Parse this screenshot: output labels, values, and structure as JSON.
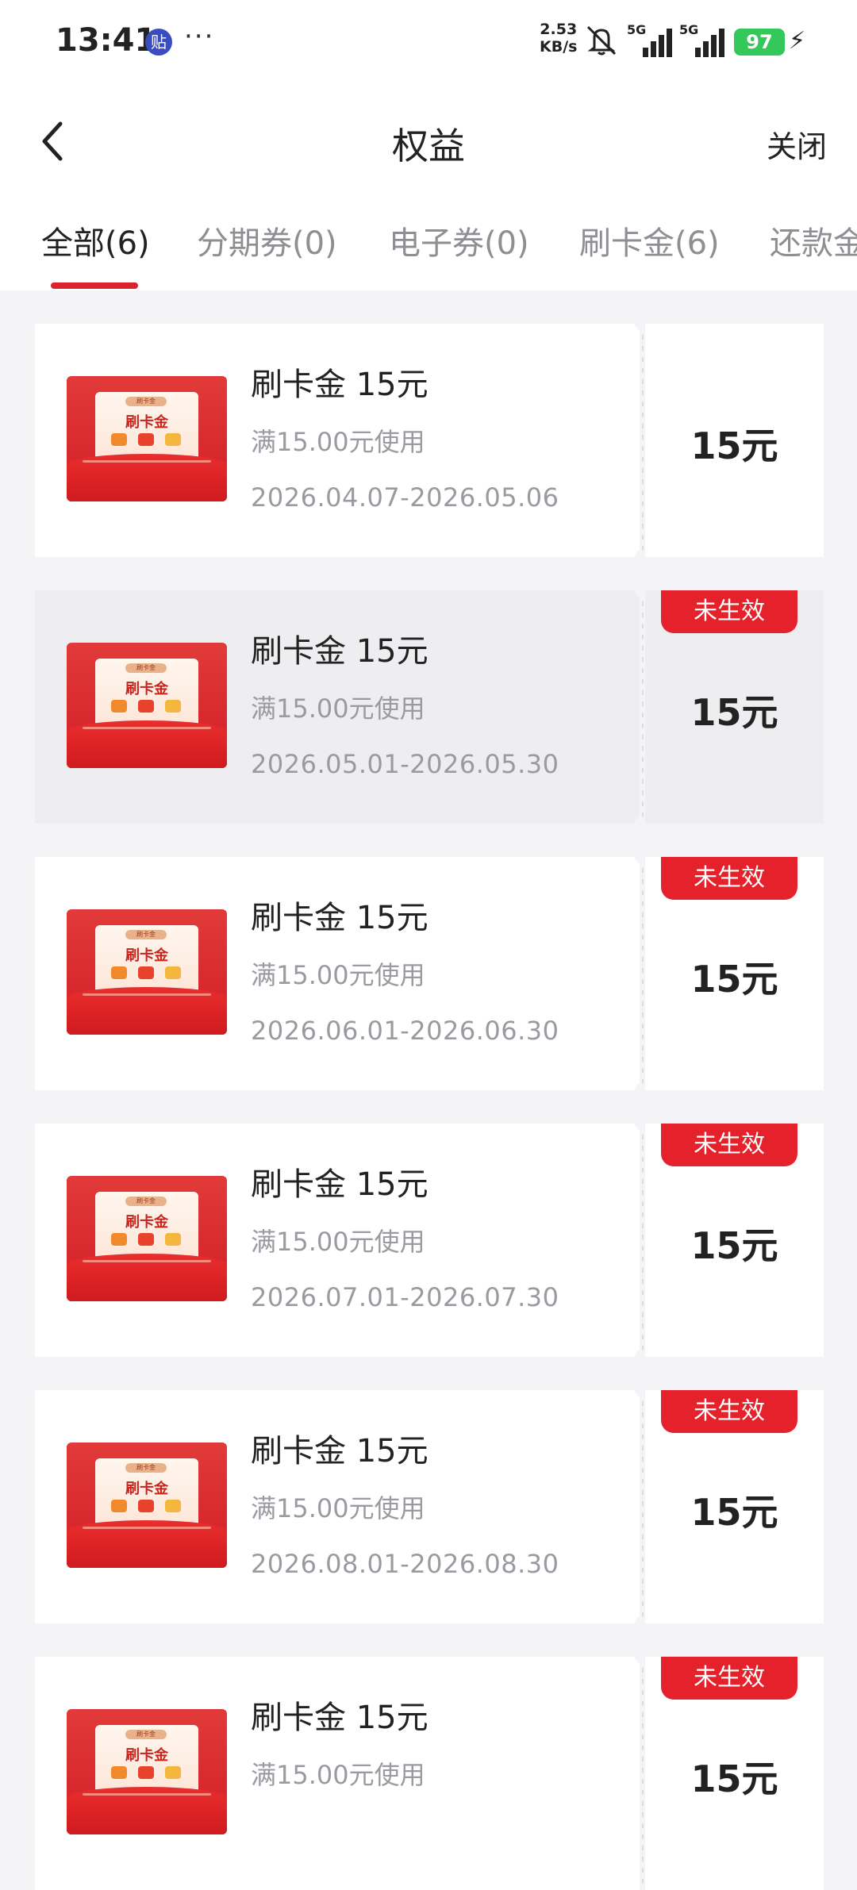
{
  "status_bar": {
    "time": "13:41",
    "app_badge": "贴",
    "more": "···",
    "net_speed_value": "2.53",
    "net_speed_unit": "KB/s",
    "signal1_label": "5G",
    "signal2_label": "5G",
    "battery": "97",
    "icons": [
      "mute-icon",
      "signal-icon",
      "battery-icon",
      "charging-icon"
    ]
  },
  "header": {
    "title": "权益",
    "close_label": "关闭",
    "back_icon": "chevron-left-icon"
  },
  "tabs": [
    {
      "label": "全部(6)",
      "active": true
    },
    {
      "label": "分期券(0)",
      "active": false
    },
    {
      "label": "电子券(0)",
      "active": false
    },
    {
      "label": "刷卡金(6)",
      "active": false
    },
    {
      "label": "还款金",
      "active": false
    }
  ],
  "thumb_text": {
    "tag": "刷卡金",
    "label": "刷卡金"
  },
  "cards": [
    {
      "title": "刷卡金 15元",
      "condition": "满15.00元使用",
      "date_range": "2026.04.07-2026.05.06",
      "amount": "15元",
      "badge": ""
    },
    {
      "title": "刷卡金 15元",
      "condition": "满15.00元使用",
      "date_range": "2026.05.01-2026.05.30",
      "amount": "15元",
      "badge": "未生效"
    },
    {
      "title": "刷卡金 15元",
      "condition": "满15.00元使用",
      "date_range": "2026.06.01-2026.06.30",
      "amount": "15元",
      "badge": "未生效"
    },
    {
      "title": "刷卡金 15元",
      "condition": "满15.00元使用",
      "date_range": "2026.07.01-2026.07.30",
      "amount": "15元",
      "badge": "未生效"
    },
    {
      "title": "刷卡金 15元",
      "condition": "满15.00元使用",
      "date_range": "2026.08.01-2026.08.30",
      "amount": "15元",
      "badge": "未生效"
    },
    {
      "title": "刷卡金 15元",
      "condition": "满15.00元使用",
      "date_range": "",
      "amount": "15元",
      "badge": "未生效"
    }
  ],
  "colors": {
    "accent": "#d9222c",
    "badge": "#e5222b",
    "page_bg": "#f4f4f6",
    "battery": "#34c759"
  }
}
